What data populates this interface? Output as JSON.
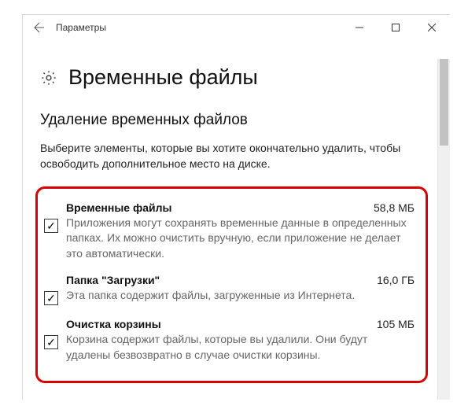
{
  "window": {
    "app_title": "Параметры"
  },
  "page": {
    "title": "Временные файлы",
    "section_title": "Удаление временных файлов",
    "section_desc": "Выберите элементы, которые вы хотите окончательно удалить, чтобы освободить дополнительное место на диске."
  },
  "items": [
    {
      "title": "Временные файлы",
      "size": "58,8 МБ",
      "desc": "Приложения могут сохранять временные данные в определенных папках. Их можно очистить вручную, если приложение не делает это автоматически.",
      "checked": true
    },
    {
      "title": "Папка \"Загрузки\"",
      "size": "16,0 ГБ",
      "desc": "Эта папка содержит файлы, загруженные из Интернета.",
      "checked": true
    },
    {
      "title": "Очистка корзины",
      "size": "105 МБ",
      "desc": "Корзина содержит файлы, которые вы удалили. Они будут удалены безвозвратно в случае очистки корзины.",
      "checked": true
    }
  ]
}
